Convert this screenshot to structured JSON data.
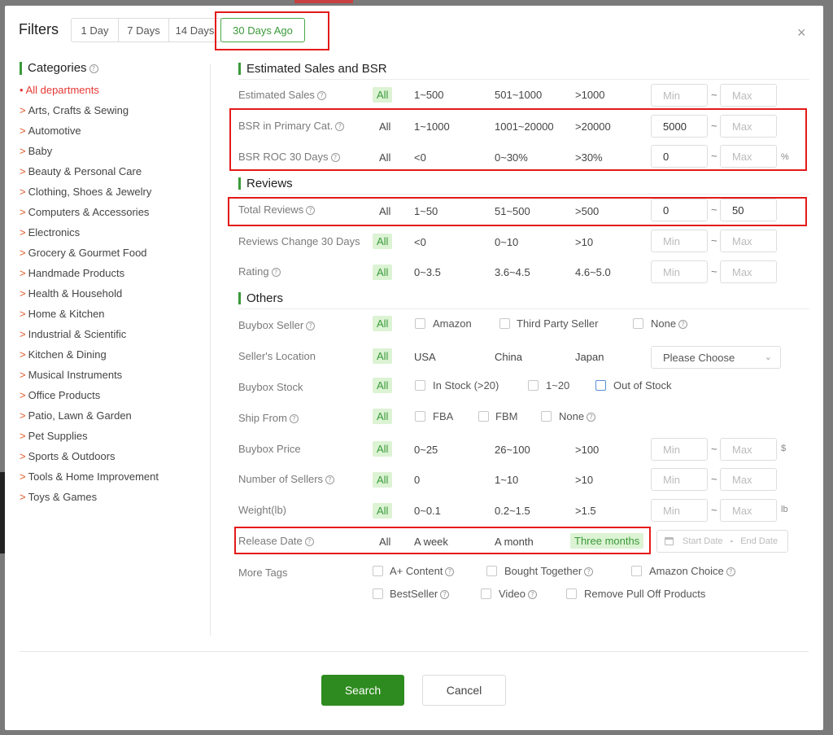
{
  "header": {
    "title": "Filters",
    "ranges": [
      "1 Day",
      "7 Days",
      "14 Days",
      "30 Days Ago"
    ],
    "active_range": "30 Days Ago",
    "close_glyph": "×"
  },
  "categories": {
    "title": "Categories",
    "items": [
      "All departments",
      "Arts, Crafts & Sewing",
      "Automotive",
      "Baby",
      "Beauty & Personal Care",
      "Clothing, Shoes & Jewelry",
      "Computers & Accessories",
      "Electronics",
      "Grocery & Gourmet Food",
      "Handmade Products",
      "Health & Household",
      "Home & Kitchen",
      "Industrial & Scientific",
      "Kitchen & Dining",
      "Musical Instruments",
      "Office Products",
      "Patio, Lawn & Garden",
      "Pet Supplies",
      "Sports & Outdoors",
      "Tools & Home Improvement",
      "Toys & Games"
    ],
    "active_index": 0
  },
  "sections": {
    "sales_bsr": "Estimated Sales and BSR",
    "reviews": "Reviews",
    "others": "Others"
  },
  "common": {
    "all": "All",
    "min": "Min",
    "max": "Max",
    "tilde": "~",
    "percent": "%",
    "dollar": "$",
    "lb": "lb"
  },
  "rows": {
    "est_sales": {
      "label": "Estimated Sales",
      "opts": [
        "1~500",
        "501~1000",
        ">1000"
      ],
      "min": "",
      "max": ""
    },
    "bsr_primary": {
      "label": "BSR in Primary Cat.",
      "opts": [
        "1~1000",
        "1001~20000",
        ">20000"
      ],
      "min": "5000",
      "max": ""
    },
    "bsr_roc": {
      "label": "BSR ROC 30 Days",
      "opts": [
        "<0",
        "0~30%",
        ">30%"
      ],
      "min": "0",
      "max": ""
    },
    "total_reviews": {
      "label": "Total Reviews",
      "opts": [
        "1~50",
        "51~500",
        ">500"
      ],
      "min": "0",
      "max": "50"
    },
    "reviews_change": {
      "label": "Reviews Change 30 Days",
      "opts": [
        "<0",
        "0~10",
        ">10"
      ],
      "min": "",
      "max": ""
    },
    "rating": {
      "label": "Rating",
      "opts": [
        "0~3.5",
        "3.6~4.5",
        "4.6~5.0"
      ],
      "min": "",
      "max": ""
    },
    "buybox_seller": {
      "label": "Buybox Seller",
      "checks": [
        "Amazon",
        "Third Party Seller",
        "None"
      ]
    },
    "seller_location": {
      "label": "Seller's Location",
      "opts": [
        "USA",
        "China",
        "Japan"
      ],
      "select_placeholder": "Please Choose"
    },
    "buybox_stock": {
      "label": "Buybox Stock",
      "checks": [
        "In Stock (>20)",
        "1~20",
        "Out of Stock"
      ]
    },
    "ship_from": {
      "label": "Ship From",
      "checks": [
        "FBA",
        "FBM",
        "None"
      ]
    },
    "buybox_price": {
      "label": "Buybox Price",
      "opts": [
        "0~25",
        "26~100",
        ">100"
      ],
      "min": "",
      "max": ""
    },
    "num_sellers": {
      "label": "Number of Sellers",
      "opts": [
        "0",
        "1~10",
        ">10"
      ],
      "min": "",
      "max": ""
    },
    "weight": {
      "label": "Weight(lb)",
      "opts": [
        "0~0.1",
        "0.2~1.5",
        ">1.5"
      ],
      "min": "",
      "max": ""
    },
    "release_date": {
      "label": "Release Date",
      "opts": [
        "A week",
        "A month",
        "Three months"
      ],
      "start": "Start Date",
      "end": "End Date",
      "dash": "-"
    },
    "more_tags": {
      "label": "More Tags",
      "checks": [
        "A+ Content",
        "Bought Together",
        "Amazon Choice",
        "BestSeller",
        "Video",
        "Remove Pull Off Products"
      ]
    }
  },
  "footer": {
    "search": "Search",
    "cancel": "Cancel"
  },
  "colors": {
    "accent": "#3a9a3a",
    "highlight": "#e41a1a",
    "selected_bg": "#dcf3d4",
    "primary_button": "#2e8b1f"
  }
}
